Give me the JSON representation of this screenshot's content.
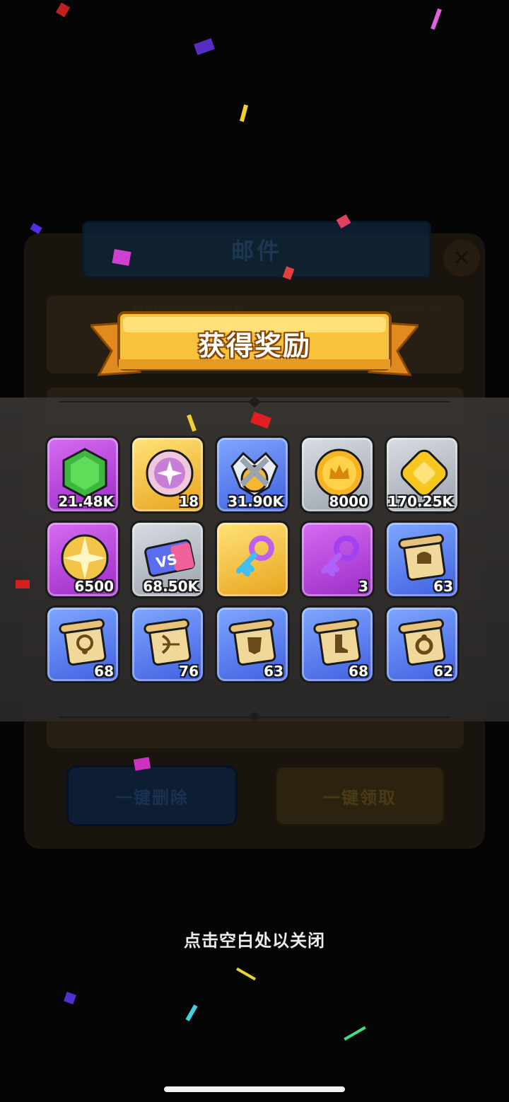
{
  "mail": {
    "title": "邮件",
    "row_title": "封印之战闯排名奖励",
    "row_date": "2026/5/25",
    "delete_all": "一键删除",
    "claim_all": "一键领取"
  },
  "reward": {
    "title": "获得奖励",
    "items": [
      {
        "icon": "green-gem-icon",
        "rarity": "purple",
        "qty": "21.48K"
      },
      {
        "icon": "pink-compass-coin-icon",
        "rarity": "gold",
        "qty": "18"
      },
      {
        "icon": "crossed-swords-badge-icon",
        "rarity": "blue",
        "qty": "31.90K"
      },
      {
        "icon": "crown-coin-icon",
        "rarity": "gray",
        "qty": "8000"
      },
      {
        "icon": "gold-nugget-icon",
        "rarity": "gray",
        "qty": "170.25K"
      },
      {
        "icon": "gold-star-medal-icon",
        "rarity": "purple",
        "qty": "6500"
      },
      {
        "icon": "vs-ticket-icon",
        "rarity": "gray",
        "qty": "68.50K"
      },
      {
        "icon": "rainbow-key-icon",
        "rarity": "gold",
        "qty": ""
      },
      {
        "icon": "purple-key-icon",
        "rarity": "purple",
        "qty": "3"
      },
      {
        "icon": "helmet-scroll-icon",
        "rarity": "blue",
        "qty": "63"
      },
      {
        "icon": "necklace-scroll-icon",
        "rarity": "blue",
        "qty": "68"
      },
      {
        "icon": "bow-scroll-icon",
        "rarity": "blue",
        "qty": "76"
      },
      {
        "icon": "armor-scroll-icon",
        "rarity": "blue",
        "qty": "63"
      },
      {
        "icon": "boot-scroll-icon",
        "rarity": "blue",
        "qty": "68"
      },
      {
        "icon": "ring-scroll-icon",
        "rarity": "blue",
        "qty": "62"
      }
    ]
  },
  "hint": "点击空白处以关闭",
  "colors": {
    "purple": "#b24fe0",
    "gold": "#f3c64a",
    "blue": "#5577ee",
    "gray": "#c0c5cc",
    "banner": "#f7c23c"
  }
}
